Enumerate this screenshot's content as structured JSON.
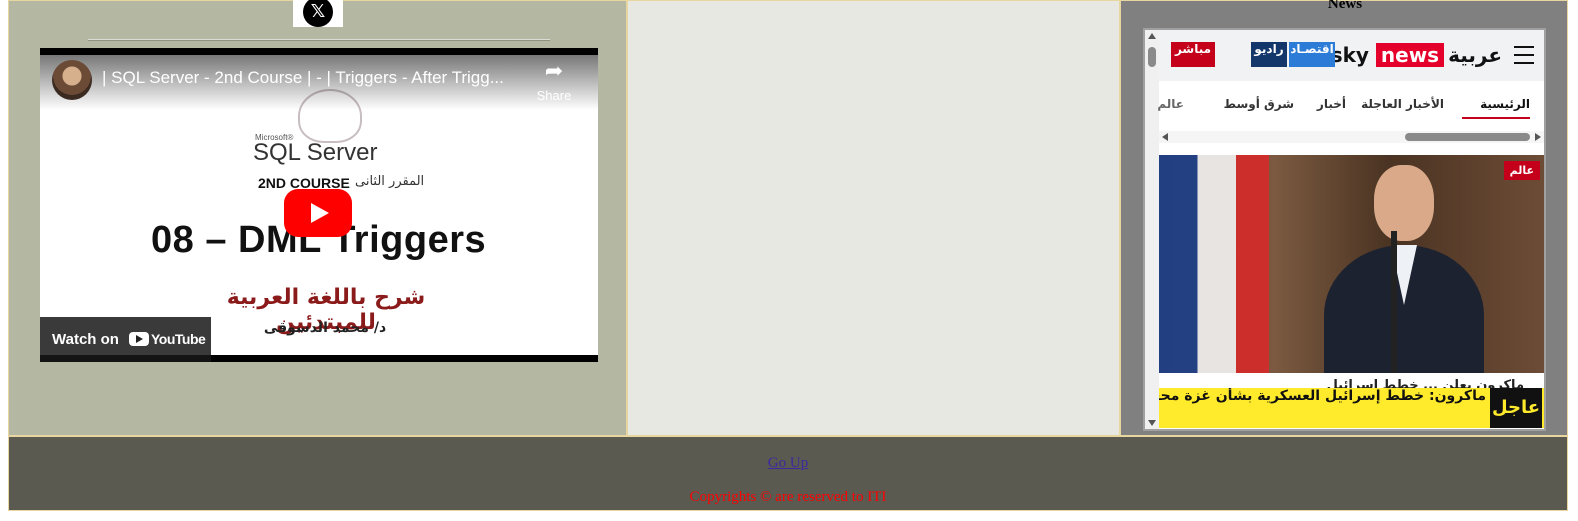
{
  "social": {
    "x_logo_glyph": "𝕏"
  },
  "video": {
    "title": "| SQL Server - 2nd Course | - | Triggers - After Trigg...",
    "share_label": "Share",
    "share_icon": "share-arrow-icon",
    "thumb_ms_label": "Microsoft®",
    "thumb_product": "SQL Server",
    "thumb_course": "2ND COURSE",
    "thumb_course_ar": "المقرر الثانى",
    "thumb_headline": "08 – DML Triggers",
    "thumb_ar_line1": "شرح باللغة العربية للمبتدئين",
    "thumb_ar_line2": "د/ محمد الدسوقى",
    "watch_on": "Watch on",
    "youtube": "YouTube"
  },
  "news": {
    "title": "News",
    "brand_ar": "عربية",
    "brand_sky": "sky",
    "brand_news": "news",
    "badges": {
      "economy": "اقتصـاد",
      "radio": "راديو",
      "live": "مباشر"
    },
    "nav": [
      "الرئيسية",
      "الأخبار العاجلة",
      "أخبار",
      "شرق أوسط",
      "عالم"
    ],
    "category_tag": "عالم",
    "breaking_label": "عاجل",
    "breaking_text": "ماكرون: خطط إسرائيل العسكرية بشأن غزة محققة",
    "headline_peek": "ماكرون يعلن ... خطط إسرائيل"
  },
  "footer": {
    "go_up": "Go Up",
    "copyright": "Copyrights © are reserved to ITI"
  },
  "colors": {
    "left_cell": "#b4b8a3",
    "middle_cell": "#e8e8e2",
    "right_cell": "#808080",
    "footer": "#5a5a51",
    "copyright_text": "#ff0000",
    "link": "#3b2a9e"
  }
}
